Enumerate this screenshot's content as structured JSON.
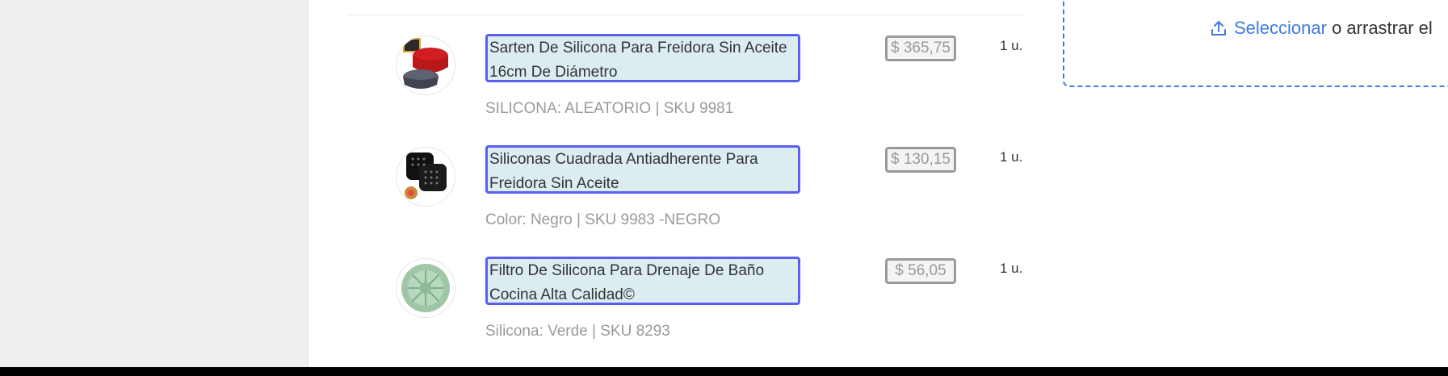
{
  "cart": {
    "items": [
      {
        "name": "Sarten De Silicona Para Freidora Sin Aceite 16cm De Diámetro",
        "variant": "SILICONA: ALEATORIO | SKU 9981",
        "price": "$ 365,75",
        "qty": "1 u.",
        "image_icon": "silicone-pans-icon"
      },
      {
        "name": "Siliconas Cuadrada Antiadherente Para Freidora Sin Aceite",
        "variant": "Color: Negro | SKU 9983 -NEGRO",
        "price": "$ 130,15",
        "qty": "1 u.",
        "image_icon": "square-silicone-mats-icon"
      },
      {
        "name": "Filtro De Silicona Para Drenaje De Baño Cocina Alta Calidad©",
        "variant": "Silicona: Verde | SKU 8293",
        "price": "$ 56,05",
        "qty": "1 u.",
        "image_icon": "green-drain-filter-icon"
      }
    ]
  },
  "upload": {
    "link_label": "Seleccionar",
    "rest_label": "o arrastrar el",
    "icon": "upload-icon"
  },
  "colors": {
    "accent": "#3f7ae0",
    "field_border": "#5b5ef0",
    "field_fill": "#dcedf2",
    "muted": "#9a9a9a"
  }
}
